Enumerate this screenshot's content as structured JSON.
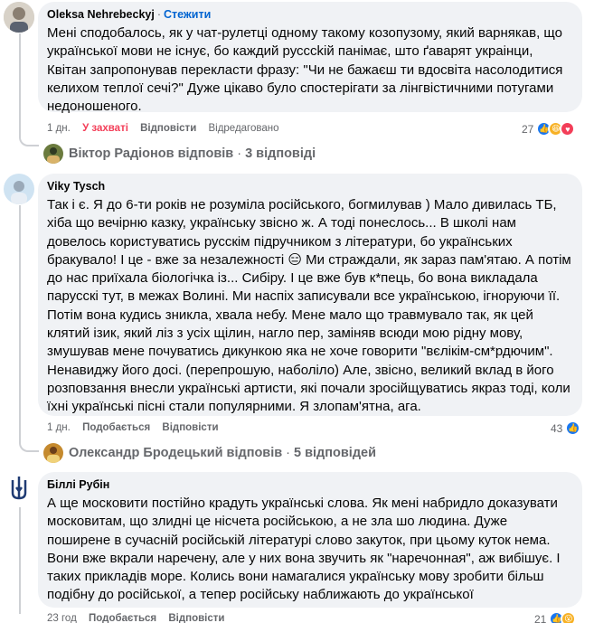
{
  "comments": [
    {
      "author": "Oleksa Nehrebeckyj",
      "follow_label": "Стежити",
      "text": "Мені сподобалось, як у чат-рулетці одному такому козопузому, який варнякав, що української мови не існує, бо каждий русссkiй панімає, што ґаварят украінци, Квітан запропонував перекласти фразу: \"Чи не бажаєш ти вдосвіта насолодитися келихом теплої сечі?\" Дуже цікаво було спостерігати за лінгвістичними потугами недоношеного.",
      "age": "1 дн.",
      "reaction_label": "У захваті",
      "reply_label": "Відповісти",
      "edited_label": "Відредаговано",
      "reaction_count": "27",
      "reply_preview": {
        "name": "Віктор Радіонов відповів",
        "count": "3 відповіді"
      }
    },
    {
      "author": "Viky Tysch",
      "text": "Так і є. Я до 6-ти років не розуміла російського, богмилував ) Мало дивилась ТБ, хіба що вечірню казку, українську звісно ж. А тоді понеслось... В школі нам довелось користуватись русскім підручником з літератури, бо українських бракувало! І це - вже за незалежності 😑 Ми страждали, як зараз пам'ятаю. А потім до нас приїхала біологічка із... Сибіру. І це вже був к*пець, бо вона викладала парусскі тут, в межах Волині. Ми наспіх записували все українською, ігноруючи її. Потім вона кудись зникла, хвала небу. Мене мало що травмувало так, як цей клятий ізик, який ліз з усіх щілин, нагло пер, заміняв всюди мою рідну мову, змушував мене почуватись дикункою яка не хоче говорити \"вєлікім-см*рдючим\". Ненавиджу його досі. (перепрошую, наболіло) Але, звісно, великий вклад в його розповзання внесли українські артисти, які почали зросійщуватись якраз тоді, коли їхні українські пісні стали популярними. Я злопам'ятна, ага.",
      "age": "1 дн.",
      "reaction_label": "Подобається",
      "reply_label": "Відповісти",
      "reaction_count": "43",
      "reply_preview": {
        "name": "Олександр Бродецький відповів",
        "count": "5 відповідей"
      }
    },
    {
      "author": "Біллі Рубін",
      "text": "А ще московити постійно крадуть українські слова. Як мені набридло доказувати московитам, що злидні це нісчета російською, а не зла шо людина. Дуже поширене в сучасній російській літературі слово закуток, при цьому куток нема. Вони вже вкрали наречену, але у них вона звучить як \"наречонная\", аж вибішує. І таких прикладів море. Колись вони намагалися українську мову зробити більш подібну до російської, а тепер російську наближають до української",
      "age": "23 год",
      "reaction_label": "Подобається",
      "reply_label": "Відповісти",
      "reaction_count": "21"
    }
  ],
  "icons": {
    "like": "thumbs-up-icon",
    "haha": "laughing-face-icon",
    "love": "heart-icon"
  },
  "colors": {
    "bubble": "#f0f2f5",
    "link": "#0064d1",
    "muted": "#65676b",
    "like": "#1877f2"
  }
}
